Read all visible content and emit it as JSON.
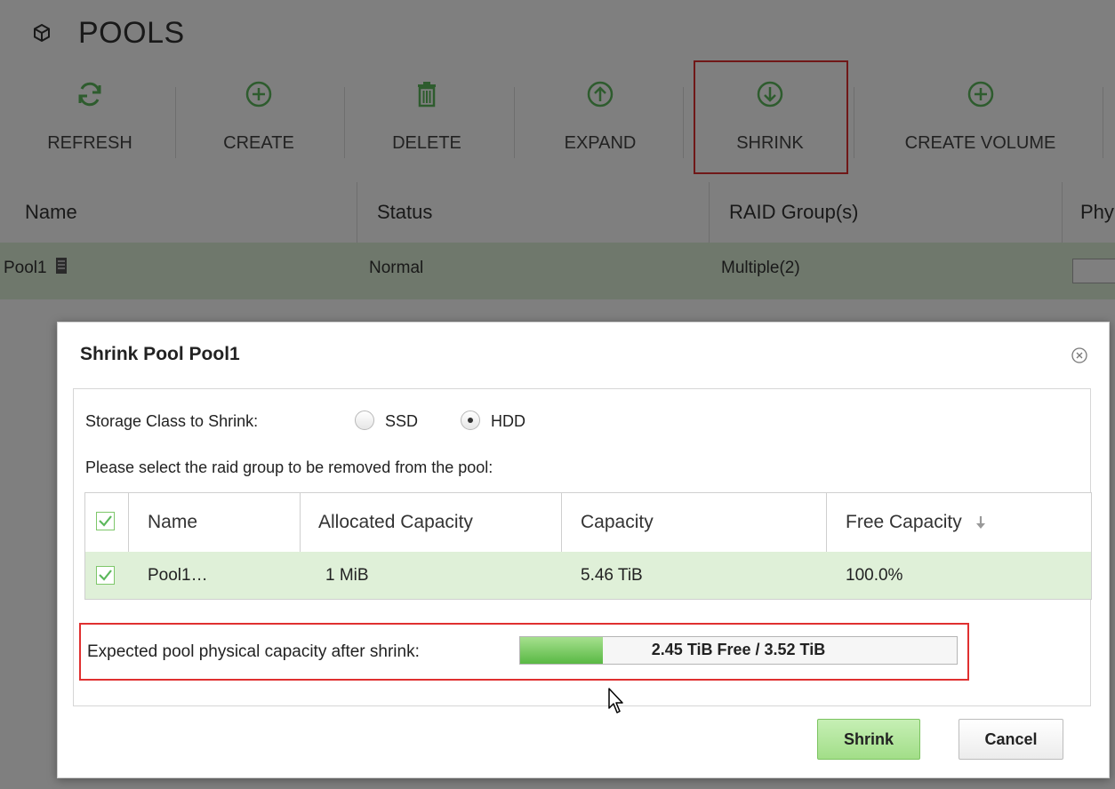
{
  "app": {
    "title": "POOLS",
    "title_icon": "cube-icon"
  },
  "toolbar": {
    "buttons": [
      {
        "id": "refresh",
        "label": "REFRESH",
        "icon": "refresh-icon"
      },
      {
        "id": "create",
        "label": "CREATE",
        "icon": "plus-circle-icon"
      },
      {
        "id": "delete",
        "label": "DELETE",
        "icon": "trash-icon"
      },
      {
        "id": "expand",
        "label": "EXPAND",
        "icon": "arrow-up-circle-icon"
      },
      {
        "id": "shrink",
        "label": "SHRINK",
        "icon": "arrow-down-circle-icon",
        "highlighted": true
      },
      {
        "id": "create_volume",
        "label": "CREATE VOLUME",
        "icon": "plus-circle-icon"
      }
    ]
  },
  "pool_table": {
    "columns": [
      "Name",
      "Status",
      "RAID Group(s)",
      "Phy"
    ],
    "rows": [
      {
        "name": "Pool1",
        "status": "Normal",
        "raid_groups": "Multiple(2)",
        "icon": "server-icon"
      }
    ]
  },
  "dialog": {
    "title_prefix": "Shrink Pool",
    "pool_name": "Pool1",
    "close_icon": "close-circle-icon",
    "storage_class": {
      "label": "Storage Class to Shrink:",
      "options": [
        "SSD",
        "HDD"
      ],
      "selected": "HDD"
    },
    "select_prompt": "Please select the raid group to be removed from the pool:",
    "raid_table": {
      "columns": [
        "Name",
        "Allocated Capacity",
        "Capacity",
        "Free Capacity"
      ],
      "sort_icon": "sort-down-icon",
      "rows": [
        {
          "name": "Pool1…",
          "allocated": "1 MiB",
          "capacity": "5.46 TiB",
          "free": "100.0%",
          "checked": true
        }
      ]
    },
    "expected": {
      "label": "Expected pool physical capacity after shrink:",
      "bar_text": "2.45 TiB Free / 3.52 TiB",
      "used_fraction": 0.19
    },
    "buttons": {
      "shrink": "Shrink",
      "cancel": "Cancel"
    }
  },
  "colors": {
    "accent_green": "#59b944",
    "row_highlight": "#dff0d8",
    "annotation_red": "#e03030"
  }
}
